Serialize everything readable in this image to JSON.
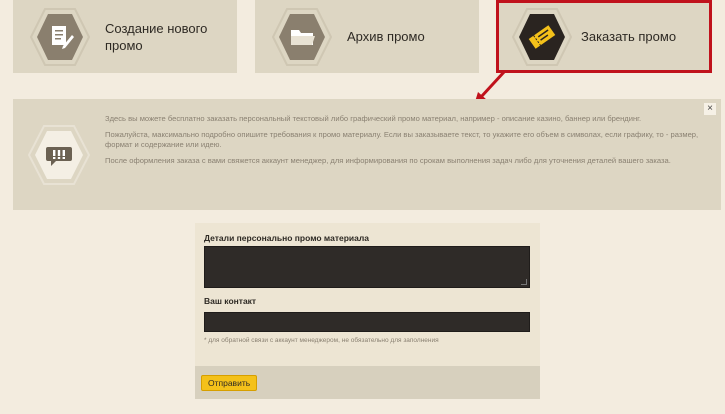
{
  "tabs": [
    {
      "label": "Создание нового промо",
      "icon": "document-edit-icon"
    },
    {
      "label": "Архив промо",
      "icon": "folder-icon"
    },
    {
      "label": "Заказать промо",
      "icon": "ticket-icon"
    }
  ],
  "info": {
    "icon": "speech-bubble-icon",
    "close_label": "×",
    "paragraphs": [
      "Здесь вы можете бесплатно заказать персональный текстовый либо графический промо материал, например - описание казино, баннер или брендинг.",
      "Пожалуйста, максимально подробно опишите требования к промо материалу. Если вы заказываете текст, то укажите его объем в символах, если графику, то - размер, формат и содержание или идею.",
      "После оформления заказа с вами свяжется аккаунт менеджер, для информирования по срокам выполнения задач либо для уточнения деталей вашего заказа."
    ]
  },
  "form": {
    "details_label": "Детали персонально промо материала",
    "details_value": "",
    "contact_label": "Ваш контакт",
    "contact_value": "",
    "hint": "* для обратной связи с аккаунт менеджером, не обязательно для заполнения",
    "submit_label": "Отправить"
  },
  "colors": {
    "accent": "#f4c11a",
    "highlight": "#c0121c",
    "panel": "#ddd6c3",
    "background": "#f3ecdf"
  }
}
